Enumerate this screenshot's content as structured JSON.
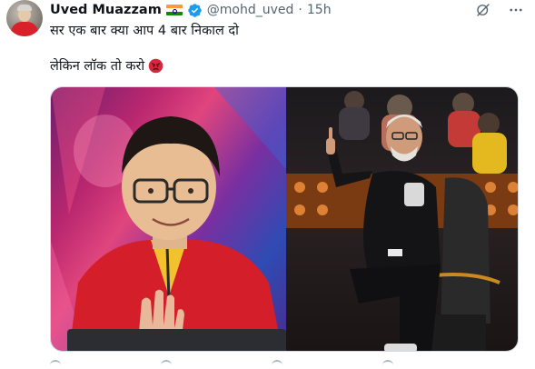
{
  "post": {
    "author_name": "Uved Muazzam",
    "handle": "@mohd_uved",
    "separator": "·",
    "time": "15h",
    "text_line1": "सर एक बार क्या आप 4 बार निकाल दो",
    "text_line2": "लेकिन लॉक तो करो"
  },
  "colors": {
    "verified_blue": "#1d9bf0",
    "muted_gray": "#536471",
    "text_dark": "#0f1419"
  },
  "icons": {
    "flag": "india-flag-icon",
    "verified": "verified-badge-icon",
    "grok": "grok-icon",
    "more": "more-options-icon",
    "emoji": "angry-face-icon"
  }
}
